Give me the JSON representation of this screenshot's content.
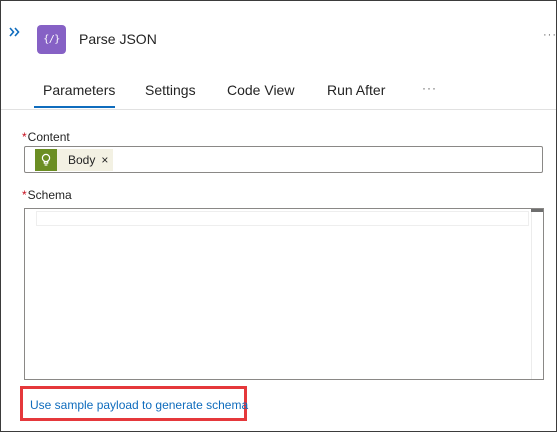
{
  "header": {
    "action_icon_glyph": "{/}",
    "action_icon_name": "parse-json-icon",
    "title": "Parse JSON",
    "more_glyph": "···",
    "accent_color": "#8661c5"
  },
  "tabs": [
    {
      "label": "Parameters",
      "active": true
    },
    {
      "label": "Settings",
      "active": false
    },
    {
      "label": "Code View",
      "active": false
    },
    {
      "label": "Run After",
      "active": false
    }
  ],
  "tabs_more_glyph": "···",
  "content_field": {
    "required_mark": "*",
    "label": "Content",
    "token": {
      "label": "Body",
      "remove_glyph": "×",
      "icon_name": "lightbulb-icon",
      "icon_color": "#6b8e23"
    }
  },
  "schema_field": {
    "required_mark": "*",
    "label": "Schema",
    "value": ""
  },
  "sample_link": {
    "text": "Use sample payload to generate schema",
    "highlight_color": "#e5383b"
  }
}
